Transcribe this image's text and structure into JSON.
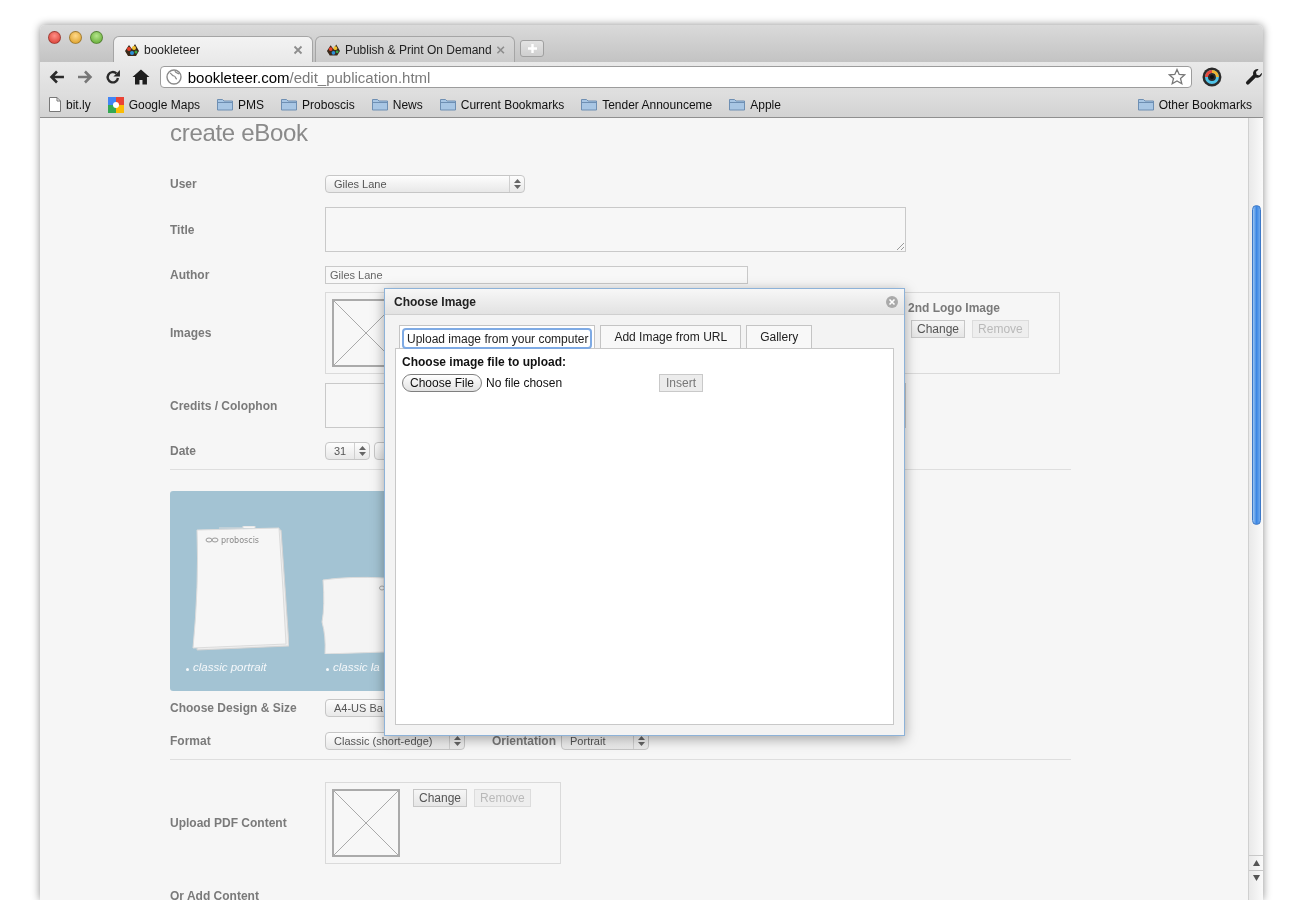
{
  "browser": {
    "tabs": [
      {
        "title": "bookleteer",
        "selected": true
      },
      {
        "title": "Publish & Print On Demand",
        "selected": false
      }
    ],
    "address": {
      "host": "bookleteer.com",
      "path": "/edit_publication.html"
    },
    "bookmarks": [
      {
        "label": "bit.ly",
        "kind": "page"
      },
      {
        "label": "Google Maps",
        "kind": "maps"
      },
      {
        "label": "PMS",
        "kind": "folder"
      },
      {
        "label": "Proboscis",
        "kind": "folder"
      },
      {
        "label": "News",
        "kind": "folder"
      },
      {
        "label": "Current Bookmarks",
        "kind": "folder"
      },
      {
        "label": "Tender Announceme",
        "kind": "folder"
      },
      {
        "label": "Apple",
        "kind": "folder"
      }
    ],
    "other_bookmarks": "Other Bookmarks"
  },
  "form": {
    "heading": "create eBook",
    "user": {
      "label": "User",
      "value": "Giles Lane"
    },
    "title": {
      "label": "Title"
    },
    "author": {
      "label": "Author",
      "value": "Giles Lane"
    },
    "images": {
      "label": "Images",
      "second_logo": {
        "heading": "2nd Logo Image",
        "buttons": [
          {
            "label": "Change",
            "disabled": false
          },
          {
            "label": "Remove",
            "disabled": true
          }
        ]
      }
    },
    "credits": {
      "label": "Credits / Colophon"
    },
    "date": {
      "label": "Date",
      "day": "31"
    },
    "designs": [
      {
        "kind": "portrait",
        "caption": "classic portrait",
        "brand": "proboscis"
      },
      {
        "kind": "landscape",
        "caption": "classic la"
      }
    ],
    "design_size": {
      "label": "Choose Design & Size",
      "value": "A4-US Ba"
    },
    "format": {
      "label": "Format",
      "value": "Classic (short-edge)"
    },
    "orientation": {
      "label": "Orientation",
      "value": "Portrait"
    },
    "pdf": {
      "label": "Upload PDF Content",
      "buttons": [
        {
          "label": "Change",
          "disabled": false
        },
        {
          "label": "Remove",
          "disabled": true
        }
      ]
    },
    "add_content": {
      "label": "Or Add Content"
    }
  },
  "dialog": {
    "title": "Choose Image",
    "tabs": [
      {
        "label": "Upload image from your computer",
        "selected": true
      },
      {
        "label": "Add Image from URL",
        "selected": false
      },
      {
        "label": "Gallery",
        "selected": false
      }
    ],
    "prompt": "Choose image file to upload:",
    "file_button": "Choose File",
    "file_status": "No file chosen",
    "insert": "Insert"
  }
}
